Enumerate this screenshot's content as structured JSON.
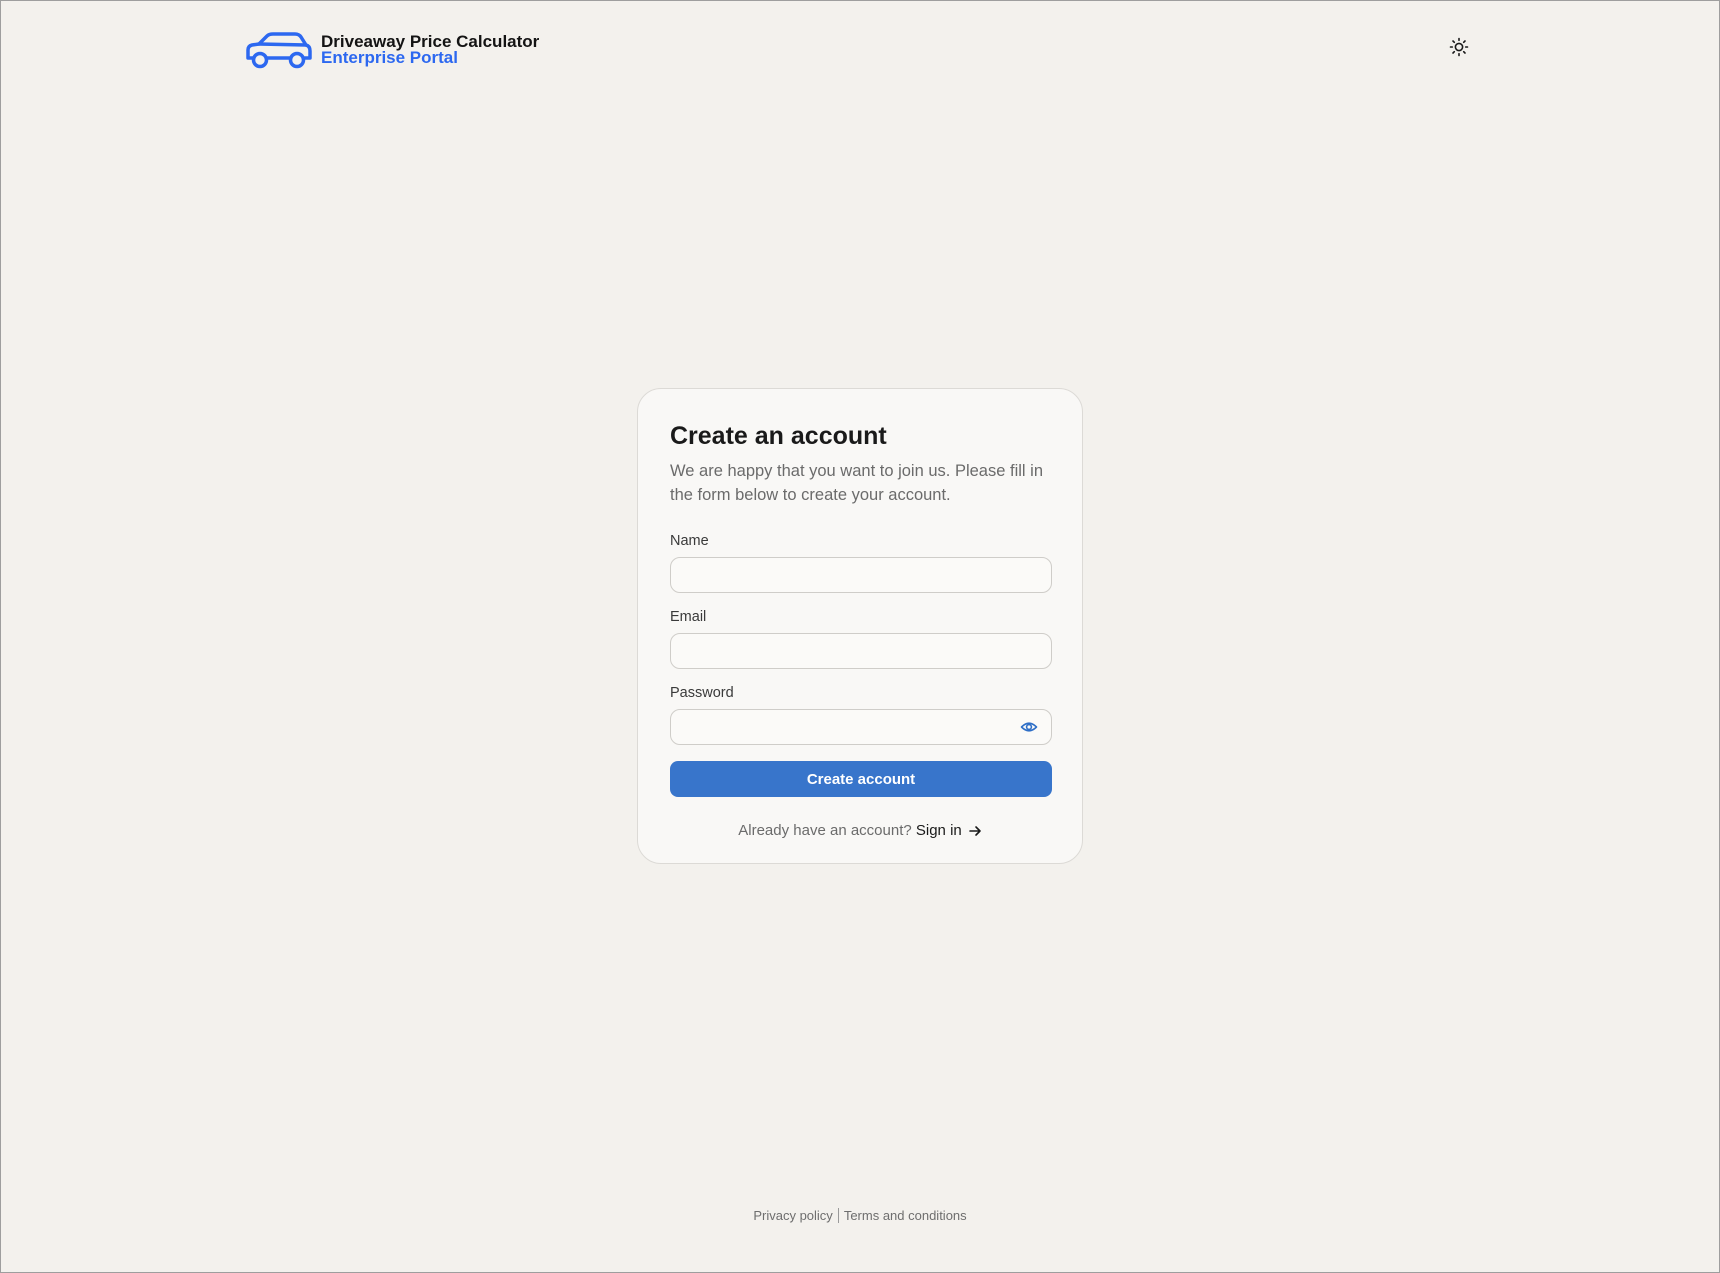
{
  "header": {
    "brand_title": "Driveaway Price Calculator",
    "brand_subtitle": "Enterprise Portal",
    "logo_icon": "car-icon",
    "theme_toggle_icon": "sun-icon"
  },
  "form": {
    "title": "Create an account",
    "subtitle": "We are happy that you want to join us. Please fill in the form below to create your account.",
    "fields": [
      {
        "label": "Name",
        "value": "",
        "placeholder": ""
      },
      {
        "label": "Email",
        "value": "",
        "placeholder": ""
      },
      {
        "label": "Password",
        "value": "",
        "placeholder": "",
        "toggle_icon": "eye-icon"
      }
    ],
    "submit_label": "Create account",
    "signin_prompt": "Already have an account?",
    "signin_link": "Sign in",
    "signin_icon": "arrow-right-icon"
  },
  "footer": {
    "privacy_label": "Privacy policy",
    "terms_label": "Terms and conditions"
  },
  "colors": {
    "background": "#f3f1ed",
    "card_background": "#f9f8f6",
    "brand_accent": "#2c68f0",
    "primary_button": "#3875cb"
  }
}
